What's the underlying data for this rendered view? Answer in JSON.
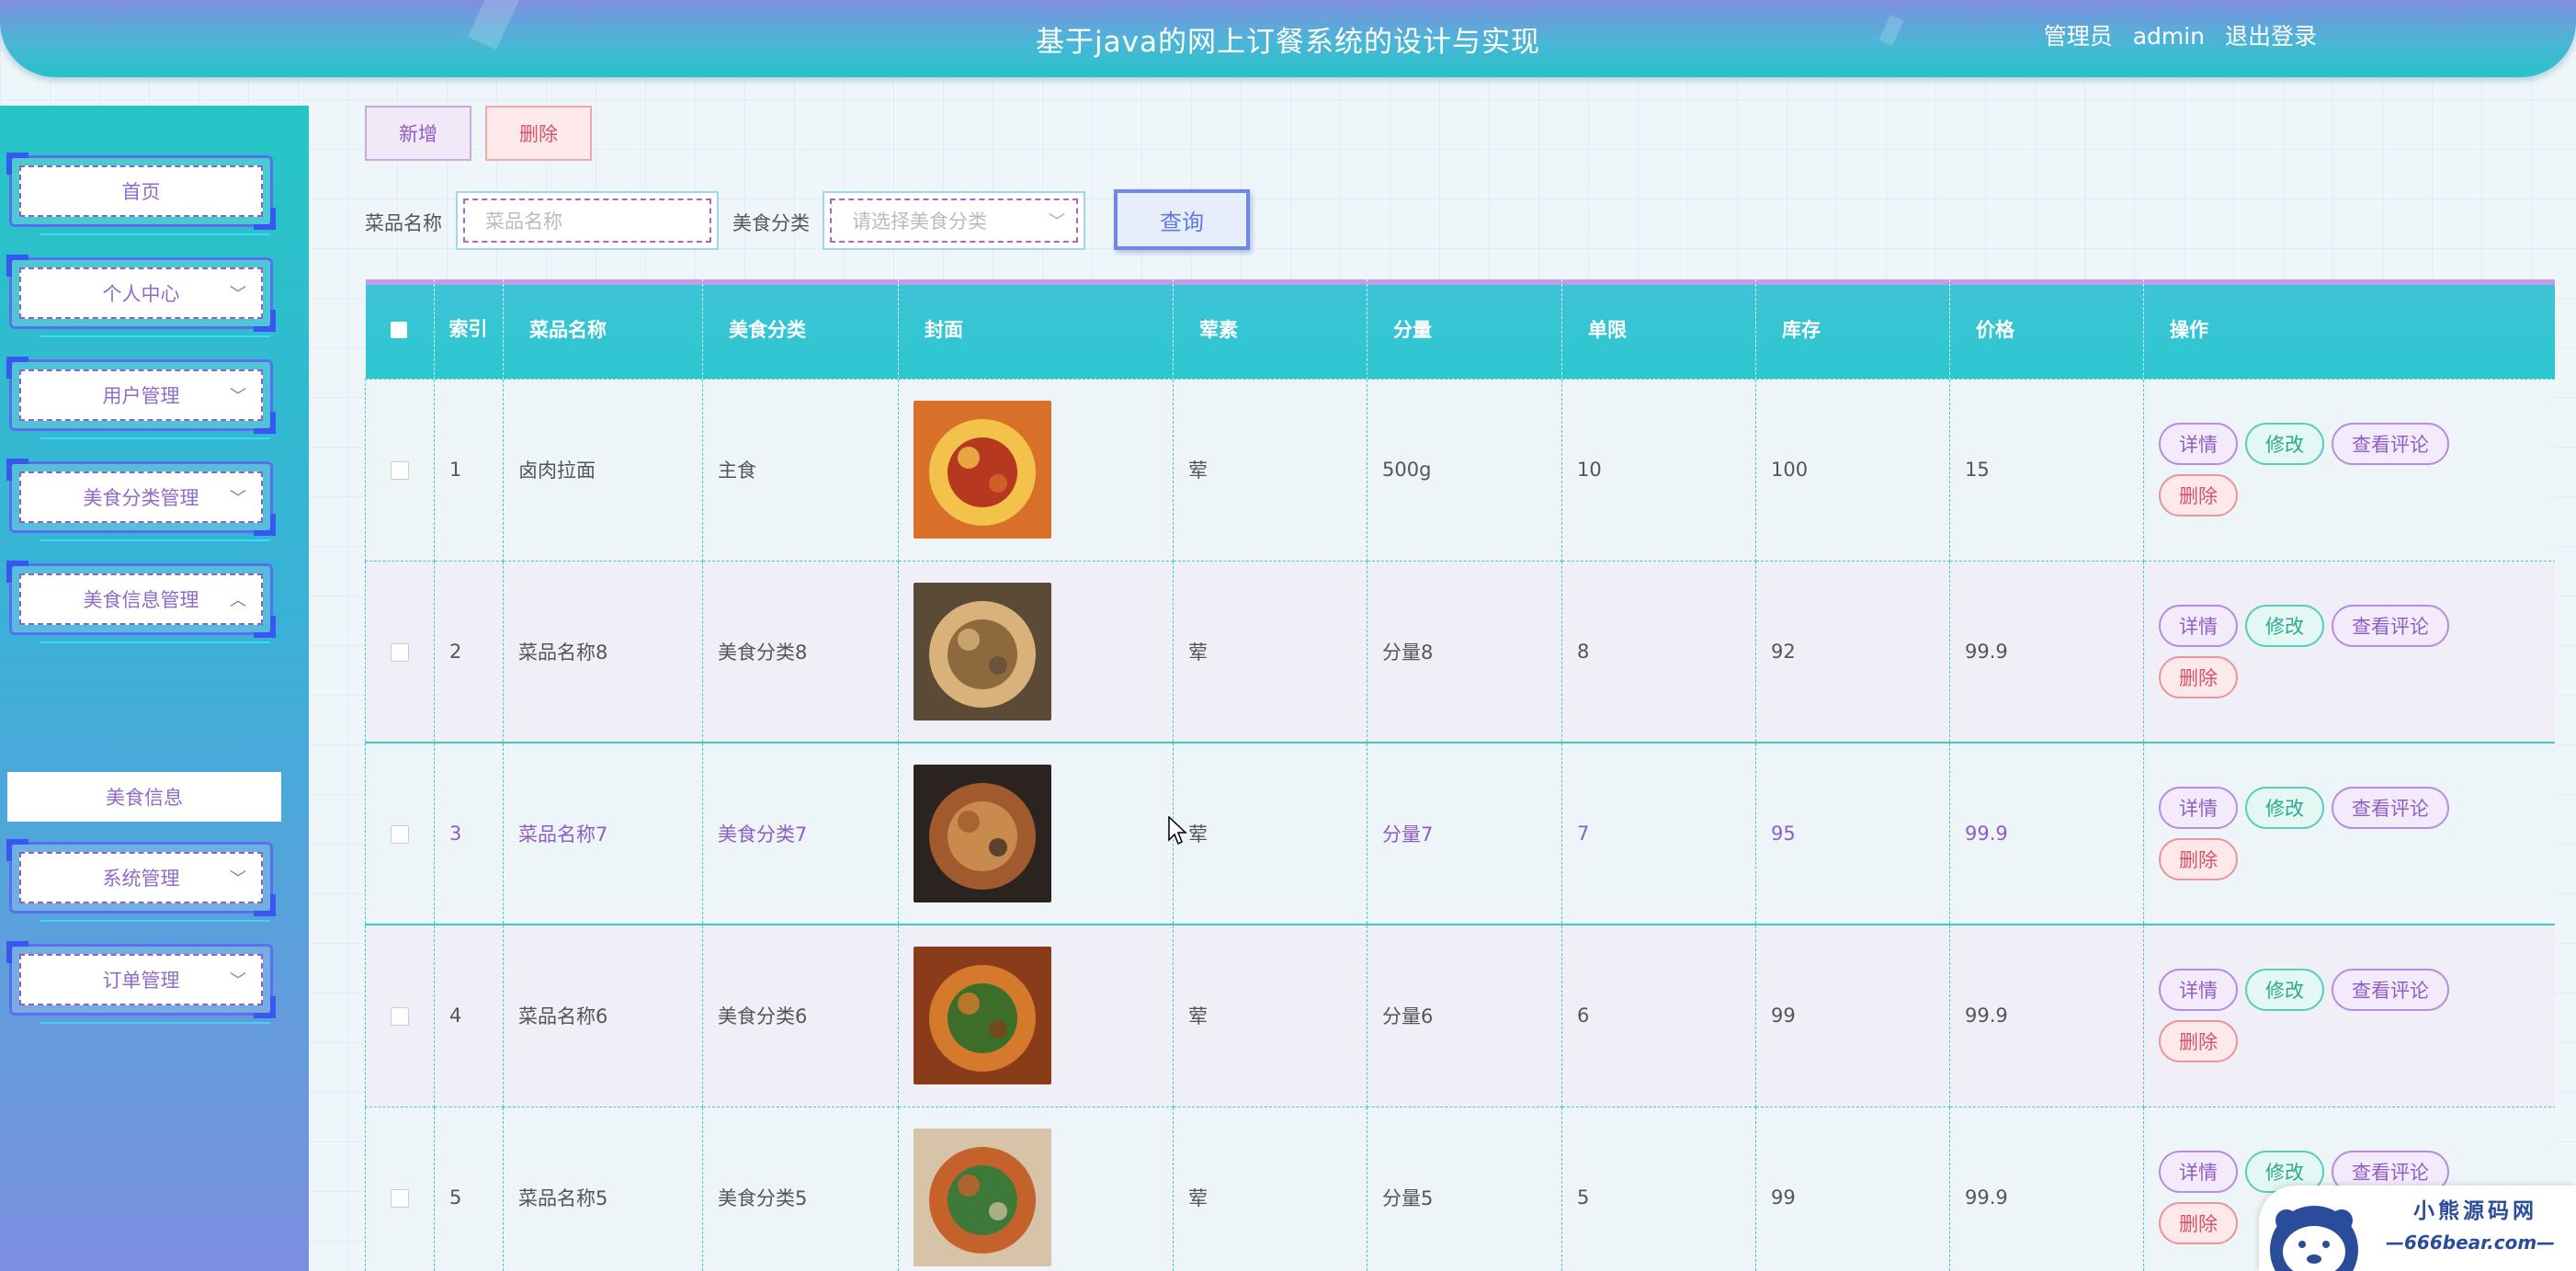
{
  "header": {
    "title": "基于java的网上订餐系统的设计与实现",
    "role": "管理员",
    "username": "admin",
    "logout": "退出登录"
  },
  "sidebar": {
    "items": [
      {
        "label": "首页",
        "chevron": ""
      },
      {
        "label": "个人中心",
        "chevron": "﹀"
      },
      {
        "label": "用户管理",
        "chevron": "﹀"
      },
      {
        "label": "美食分类管理",
        "chevron": "﹀"
      },
      {
        "label": "美食信息管理",
        "chevron": "︿"
      },
      {
        "label": "系统管理",
        "chevron": "﹀"
      },
      {
        "label": "订单管理",
        "chevron": "﹀"
      }
    ],
    "submenu": "美食信息"
  },
  "toolbar": {
    "add": "新增",
    "delete": "删除"
  },
  "search": {
    "name_label": "菜品名称",
    "name_placeholder": "菜品名称",
    "category_label": "美食分类",
    "category_placeholder": "请选择美食分类",
    "query": "查询"
  },
  "table": {
    "headers": {
      "index": "索引",
      "name": "菜品名称",
      "category": "美食分类",
      "cover": "封面",
      "meat": "荤素",
      "portion": "分量",
      "limit": "单限",
      "stock": "库存",
      "price": "价格",
      "ops": "操作"
    },
    "rows": [
      {
        "index": "1",
        "name": "卤肉拉面",
        "category": "主食",
        "meat": "荤",
        "portion": "500g",
        "limit": "10",
        "stock": "100",
        "price": "15"
      },
      {
        "index": "2",
        "name": "菜品名称8",
        "category": "美食分类8",
        "meat": "荤",
        "portion": "分量8",
        "limit": "8",
        "stock": "92",
        "price": "99.9"
      },
      {
        "index": "3",
        "name": "菜品名称7",
        "category": "美食分类7",
        "meat": "荤",
        "portion": "分量7",
        "limit": "7",
        "stock": "95",
        "price": "99.9"
      },
      {
        "index": "4",
        "name": "菜品名称6",
        "category": "美食分类6",
        "meat": "荤",
        "portion": "分量6",
        "limit": "6",
        "stock": "99",
        "price": "99.9"
      },
      {
        "index": "5",
        "name": "菜品名称5",
        "category": "美食分类5",
        "meat": "荤",
        "portion": "分量5",
        "limit": "5",
        "stock": "99",
        "price": "99.9"
      }
    ],
    "ops": {
      "detail": "详情",
      "edit": "修改",
      "review": "查看评论",
      "delete": "删除"
    }
  },
  "watermark": {
    "line1": "小熊源码网",
    "line2": "—666bear.com—"
  }
}
